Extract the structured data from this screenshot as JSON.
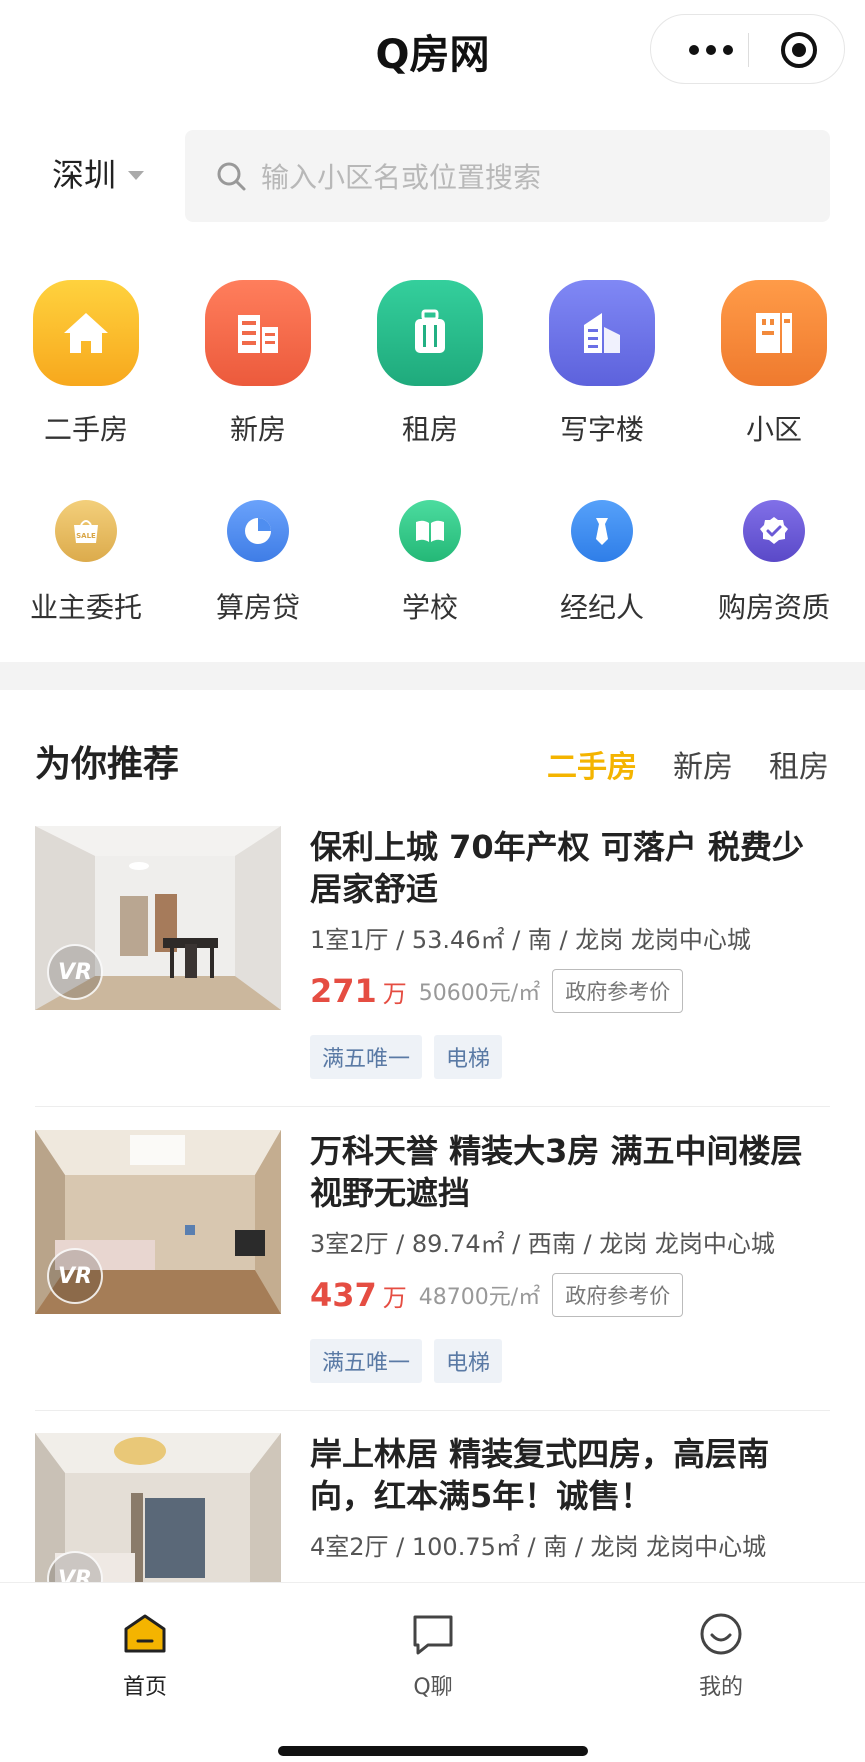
{
  "header": {
    "title": "Q房网"
  },
  "search": {
    "city": "深圳",
    "placeholder": "输入小区名或位置搜索"
  },
  "categories_main": [
    {
      "label": "二手房",
      "icon": "house-icon",
      "color": "#f9b82a"
    },
    {
      "label": "新房",
      "icon": "building-icon",
      "color": "#f26a4b"
    },
    {
      "label": "租房",
      "icon": "luggage-icon",
      "color": "#2cba8e"
    },
    {
      "label": "写字楼",
      "icon": "office-icon",
      "color": "#6f72e8"
    },
    {
      "label": "小区",
      "icon": "community-icon",
      "color": "#f28a3b"
    }
  ],
  "categories_sub": [
    {
      "label": "业主委托",
      "icon": "sale-tag-icon",
      "color": "#e7b558"
    },
    {
      "label": "算房贷",
      "icon": "pie-chart-icon",
      "color": "#4f8ef0"
    },
    {
      "label": "学校",
      "icon": "book-icon",
      "color": "#36c98a"
    },
    {
      "label": "经纪人",
      "icon": "tie-icon",
      "color": "#3d8ff2"
    },
    {
      "label": "购房资质",
      "icon": "badge-check-icon",
      "color": "#6b5ad6"
    }
  ],
  "recommend": {
    "title": "为你推荐",
    "tabs": [
      "二手房",
      "新房",
      "租房"
    ],
    "active_tab": "二手房",
    "listings": [
      {
        "title": "保利上城 70年产权 可落户 税费少 居家舒适",
        "meta": "1室1厅 / 53.46㎡ / 南 / 龙岗 龙岗中心城",
        "price": "271",
        "price_unit": "万",
        "unit_price": "50600元/㎡",
        "gov_label": "政府参考价",
        "tags": [
          "满五唯一",
          "电梯"
        ],
        "vr": "VR"
      },
      {
        "title": "万科天誉 精装大3房  满五中间楼层 视野无遮挡",
        "meta": "3室2厅 / 89.74㎡ / 西南 / 龙岗 龙岗中心城",
        "price": "437",
        "price_unit": "万",
        "unit_price": "48700元/㎡",
        "gov_label": "政府参考价",
        "tags": [
          "满五唯一",
          "电梯"
        ],
        "vr": "VR"
      },
      {
        "title": "岸上林居 精装复式四房，高层南向，红本满5年！诚售！",
        "meta": "4室2厅 / 100.75㎡ / 南 / 龙岗 龙岗中心城",
        "vr": "VR"
      }
    ]
  },
  "bottom_nav": [
    {
      "label": "首页",
      "icon": "home-icon"
    },
    {
      "label": "Q聊",
      "icon": "chat-icon"
    },
    {
      "label": "我的",
      "icon": "profile-icon"
    }
  ]
}
